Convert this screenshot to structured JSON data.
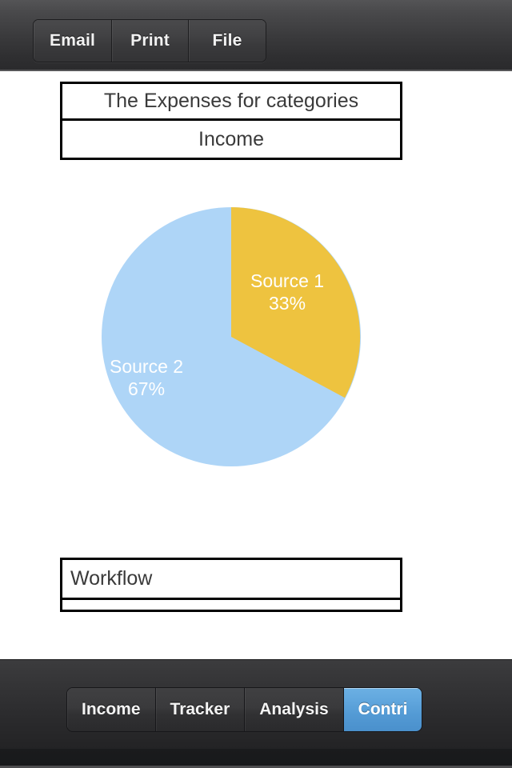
{
  "toolbar": {
    "buttons": [
      {
        "label": "Email",
        "name": "email-button"
      },
      {
        "label": "Print",
        "name": "print-button"
      },
      {
        "label": "File",
        "name": "file-button"
      }
    ]
  },
  "header_table": {
    "rows": [
      {
        "text": "The Expenses for categories"
      },
      {
        "text": "Income"
      }
    ]
  },
  "footer_table": {
    "rows": [
      {
        "text": "Workflow"
      },
      {
        "text": ""
      }
    ]
  },
  "tabbar": {
    "tabs": [
      {
        "label": "Income",
        "selected": false
      },
      {
        "label": "Tracker",
        "selected": false
      },
      {
        "label": "Analysis",
        "selected": false
      },
      {
        "label": "Contri",
        "selected": true
      }
    ]
  },
  "colors": {
    "slice_1": "#eec33f",
    "slice_2": "#aed5f7",
    "accent_selected_tab": "#5ba0da",
    "bar_dark": "#2c2c2e",
    "table_border": "#000000",
    "table_text": "#3a3a3a"
  },
  "chart_data": {
    "type": "pie",
    "title": "Income",
    "subtitle": "The Expenses for categories",
    "categories": [
      "Source 1",
      "Source 2"
    ],
    "values": [
      33,
      67
    ],
    "value_unit": "%",
    "labels": [
      "Source 1\n33%",
      "Source 2\n67%"
    ],
    "slices": [
      {
        "name": "Source 1",
        "percent": 33,
        "percent_label": "33%",
        "color": "#eec33f",
        "start_angle_deg": 0,
        "end_angle_deg": 118.8
      },
      {
        "name": "Source 2",
        "percent": 67,
        "percent_label": "67%",
        "color": "#aed5f7",
        "start_angle_deg": 118.8,
        "end_angle_deg": 360
      }
    ],
    "start_angle": "12 o'clock",
    "direction": "clockwise",
    "legend": "inside-slices",
    "label_color": "#ffffff",
    "grid": false
  }
}
